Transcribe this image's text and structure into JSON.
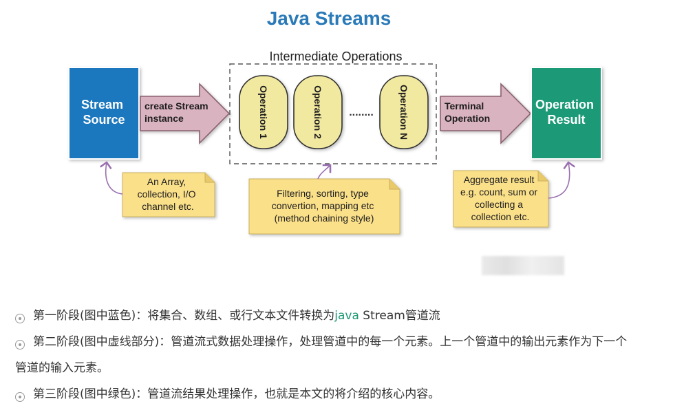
{
  "diagram": {
    "title": "Java Streams",
    "intermediate_label": "Intermediate Operations",
    "stream_source": [
      "Stream",
      "Source"
    ],
    "operation_result": [
      "Operation",
      "Result"
    ],
    "arrow_create": [
      "create Stream",
      "instance"
    ],
    "arrow_terminal": [
      "Terminal",
      "Operation"
    ],
    "operations": [
      "Operation 1",
      "Operation 2",
      "Operation N"
    ],
    "ellipsis": "........",
    "note_source": [
      "An Array,",
      "collection, I/O",
      "channel etc."
    ],
    "note_intermediate": [
      "Filtering, sorting, type",
      "convertion, mapping etc",
      "(method chaining style)"
    ],
    "note_result": [
      "Aggregate result",
      "e.g. count, sum or",
      "collecting a",
      "collection etc."
    ],
    "colors": {
      "title": "#2a7ab8",
      "source_box": "#1a78be",
      "result_box": "#1b9a78",
      "arrow_fill": "#d9b3bf",
      "operation_fill": "#f2e9a0",
      "note_fill": "#fbe08a",
      "connector": "#9a6fb0"
    }
  },
  "bullets": [
    {
      "text_before": "第一阶段(图中蓝色)：将集合、数组、或行文本文件转换为",
      "highlight": "java",
      "text_after": " Stream管道流"
    },
    {
      "text": "第二阶段(图中虚线部分)：管道流式数据处理操作，处理管道中的每一个元素。上一个管道中的输出元素作为下一个",
      "continuation": "管道的输入元素。"
    },
    {
      "text": "第三阶段(图中绿色)：管道流结果处理操作，也就是本文的将介绍的核心内容。"
    }
  ]
}
